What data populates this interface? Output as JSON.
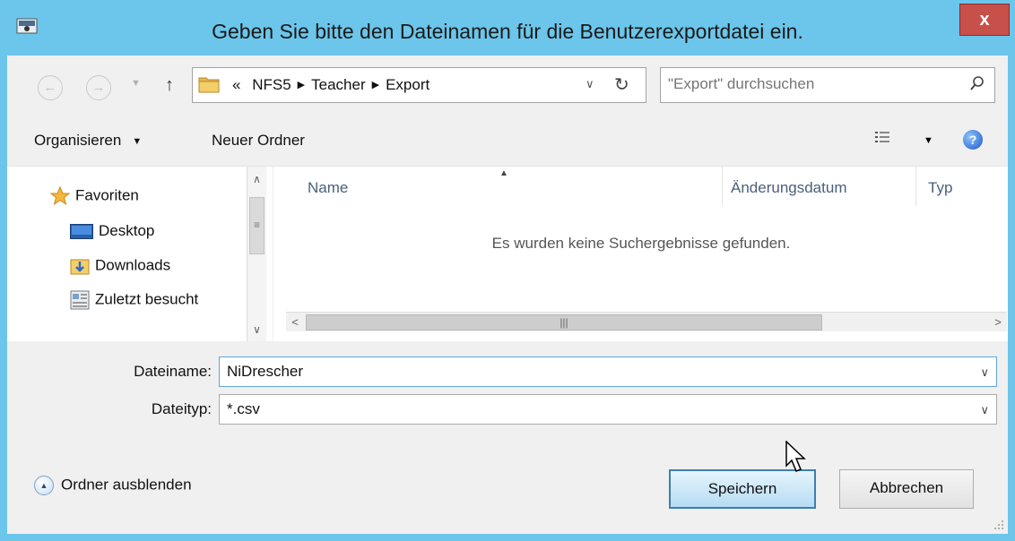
{
  "window": {
    "title": "Geben Sie bitte den Dateinamen für die Benutzerexportdatei ein.",
    "close_label": "x"
  },
  "navigation": {
    "back_icon": "back-arrow-icon",
    "forward_icon": "forward-arrow-icon",
    "up_icon": "up-arrow-icon",
    "breadcrumb_overflow": "«",
    "breadcrumbs": [
      "NFS5",
      "Teacher",
      "Export"
    ],
    "search_placeholder": "\"Export\" durchsuchen"
  },
  "toolbar": {
    "organize_label": "Organisieren",
    "new_folder_label": "Neuer Ordner",
    "help_label": "?"
  },
  "nav_pane": {
    "favorites_label": "Favoriten",
    "items": [
      {
        "label": "Desktop",
        "icon": "desktop-icon"
      },
      {
        "label": "Downloads",
        "icon": "downloads-folder-icon"
      },
      {
        "label": "Zuletzt besucht",
        "icon": "recent-places-icon"
      }
    ]
  },
  "file_list": {
    "columns": [
      "Name",
      "Änderungsdatum",
      "Typ"
    ],
    "empty_message": "Es wurden keine Suchergebnisse gefunden."
  },
  "form": {
    "filename_label": "Dateiname:",
    "filename_value": "NiDrescher",
    "filetype_label": "Dateityp:",
    "filetype_value": "*.csv"
  },
  "footer": {
    "hide_folders_label": "Ordner ausblenden",
    "save_label": "Speichern",
    "cancel_label": "Abbrechen"
  },
  "colors": {
    "title_bar": "#6cc5ea",
    "close_button": "#c7504a",
    "primary_button": "#b6dcf3"
  }
}
